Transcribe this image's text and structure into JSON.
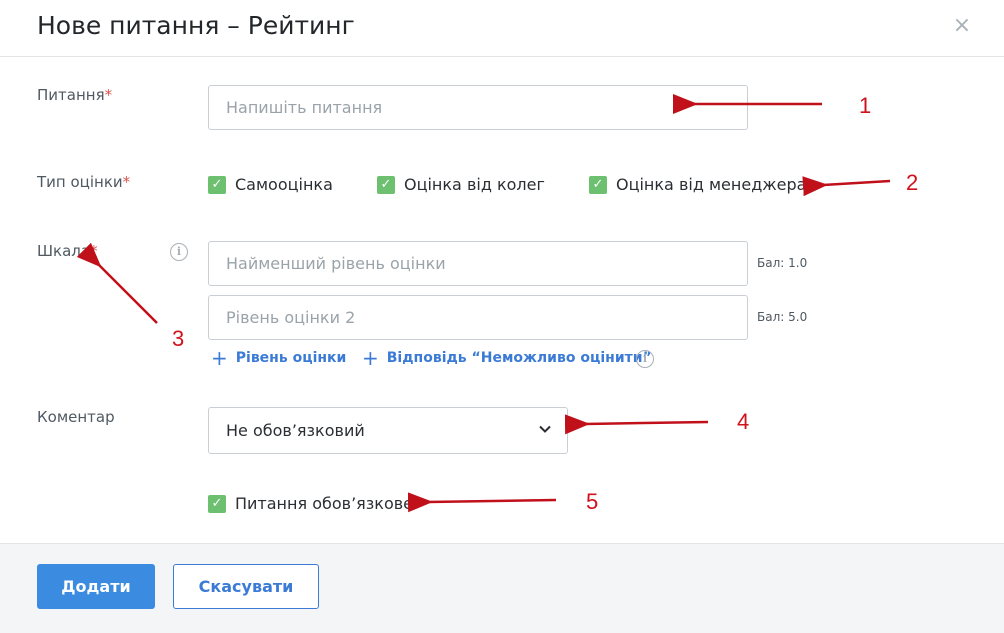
{
  "dialog": {
    "title": "Нове питання – Рейтинг",
    "close_glyph": "×"
  },
  "form": {
    "question": {
      "label": "Питання",
      "required_mark": "*",
      "placeholder": "Напишіть питання"
    },
    "rating_type": {
      "label": "Тип оцінки",
      "required_mark": "*",
      "options": [
        {
          "label": "Самооцінка",
          "checked": true
        },
        {
          "label": "Оцінка від колег",
          "checked": true
        },
        {
          "label": "Оцінка від менеджера",
          "checked": true
        }
      ]
    },
    "scale": {
      "label": "Шкала",
      "required_mark": "*",
      "levels": [
        {
          "placeholder": "Найменший рівень оцінки",
          "score": "Бал: 1.0"
        },
        {
          "placeholder": "Рівень оцінки 2",
          "score": "Бал: 5.0"
        }
      ],
      "add_level_label": "Рівень оцінки",
      "add_answer_label": "Відповідь “Неможливо оцінити”"
    },
    "comment": {
      "label": "Коментар",
      "selected": "Не обов’язковий"
    },
    "required_question": {
      "label": "Питання обов’язкове",
      "checked": true
    }
  },
  "footer": {
    "add_label": "Додати",
    "cancel_label": "Скасувати"
  },
  "annotations": [
    "1",
    "2",
    "3",
    "4",
    "5"
  ],
  "colors": {
    "primary": "#3b8be0",
    "checkbox": "#6cc070",
    "annotation": "#d0121b",
    "required": "#d9534f"
  }
}
